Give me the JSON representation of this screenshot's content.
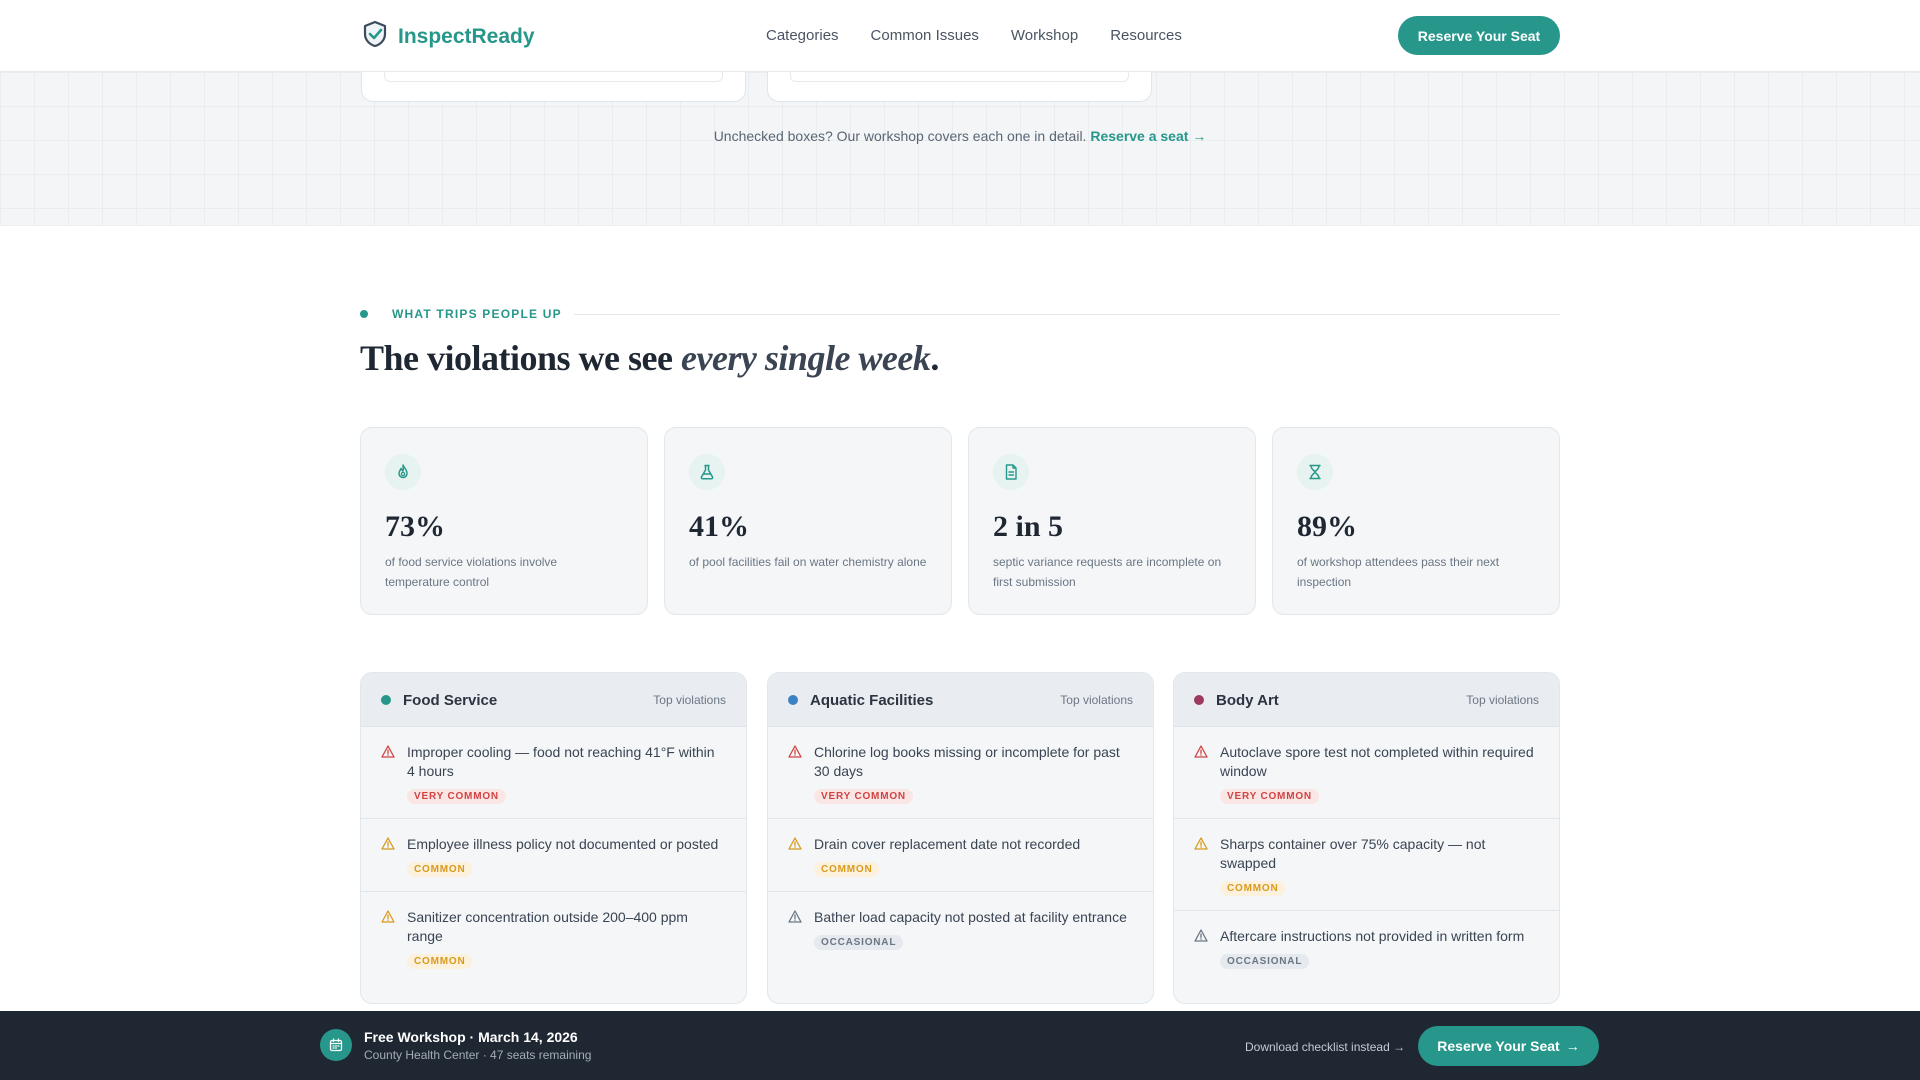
{
  "header": {
    "brand": "InspectReady",
    "nav": [
      "Categories",
      "Common Issues",
      "Workshop",
      "Resources"
    ],
    "cta": "Reserve Your Seat"
  },
  "grid_note": {
    "text": "Unchecked boxes? Our workshop covers each one in detail.",
    "link": "Reserve a seat →"
  },
  "section": {
    "eyebrow": "WHAT TRIPS PEOPLE UP",
    "headline_plain": "The violations we see ",
    "headline_italic": "every single week",
    "headline_end": "."
  },
  "stats": [
    {
      "icon": "flame-icon",
      "value": "73%",
      "desc": "of food service violations involve temperature control"
    },
    {
      "icon": "flask-icon",
      "value": "41%",
      "desc": "of pool facilities fail on water chemistry alone"
    },
    {
      "icon": "document-icon",
      "value": "2 in 5",
      "desc": "septic variance requests are incomplete on first submission"
    },
    {
      "icon": "hourglass-icon",
      "value": "89%",
      "desc": "of workshop attendees pass their next inspection"
    }
  ],
  "categories": [
    {
      "name": "Food Service",
      "top_label": "Top violations",
      "color": "#26978a",
      "items": [
        {
          "text": "Improper cooling — food not reaching 41°F within 4 hours",
          "badge": "VERY COMMON",
          "level": "very"
        },
        {
          "text": "Employee illness policy not documented or posted",
          "badge": "COMMON",
          "level": "common"
        },
        {
          "text": "Sanitizer concentration outside 200–400 ppm range",
          "badge": "COMMON",
          "level": "common"
        }
      ]
    },
    {
      "name": "Aquatic Facilities",
      "top_label": "Top violations",
      "color": "#3b82c4",
      "items": [
        {
          "text": "Chlorine log books missing or incomplete for past 30 days",
          "badge": "VERY COMMON",
          "level": "very"
        },
        {
          "text": "Drain cover replacement date not recorded",
          "badge": "COMMON",
          "level": "common"
        },
        {
          "text": "Bather load capacity not posted at facility entrance",
          "badge": "OCCASIONAL",
          "level": "occ"
        }
      ]
    },
    {
      "name": "Body Art",
      "top_label": "Top violations",
      "color": "#9b3a5e",
      "items": [
        {
          "text": "Autoclave spore test not completed within required window",
          "badge": "VERY COMMON",
          "level": "very"
        },
        {
          "text": "Sharps container over 75% capacity — not swapped",
          "badge": "COMMON",
          "level": "common"
        },
        {
          "text": "Aftercare instructions not provided in written form",
          "badge": "OCCASIONAL",
          "level": "occ"
        }
      ]
    }
  ],
  "bottom_bar": {
    "title": "Free Workshop · March 14, 2026",
    "subtitle": "County Health Center · 47 seats remaining",
    "link": "Download checklist instead →",
    "cta": "Reserve Your Seat",
    "cta_arrow": "→"
  },
  "colors": {
    "accent": "#26978a",
    "very_common": "#d14343",
    "common": "#d99a1e",
    "occasional": "#6b7684"
  }
}
